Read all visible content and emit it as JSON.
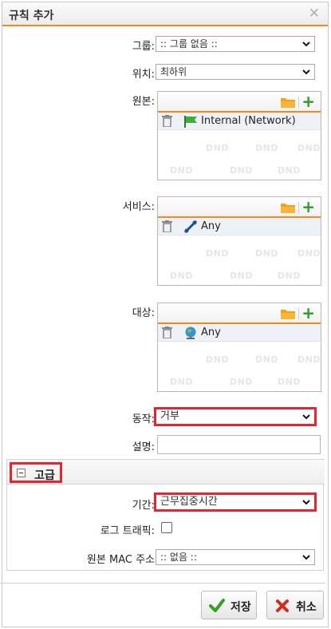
{
  "dialog": {
    "title": "규칙 추가",
    "close_symbol": "✕"
  },
  "form": {
    "group_label": "그룹:",
    "group_value": ":: 그룹 없음 ::",
    "position_label": "위치:",
    "position_value": "최하위",
    "source_label": "원본:",
    "service_label": "서비스:",
    "destination_label": "대상:",
    "action_label": "동작:",
    "action_value": "거부",
    "description_label": "설명:"
  },
  "source": {
    "item": "Internal (Network)"
  },
  "service": {
    "item": "Any"
  },
  "destination": {
    "item": "Any"
  },
  "watermark": "DND",
  "advanced": {
    "title": "고급",
    "period_label": "기간:",
    "period_value": "근무집중시간",
    "log_label": "로그 트래픽:",
    "mac_label": "원본 MAC 주소",
    "mac_value": ":: 없음 ::"
  },
  "buttons": {
    "save": "저장",
    "cancel": "취소"
  },
  "colors": {
    "accent": "#f08a1c",
    "highlight": "#e32631",
    "add": "#2e9a2e",
    "save_check": "#3a9c2c",
    "cancel_x": "#d62a1e"
  }
}
